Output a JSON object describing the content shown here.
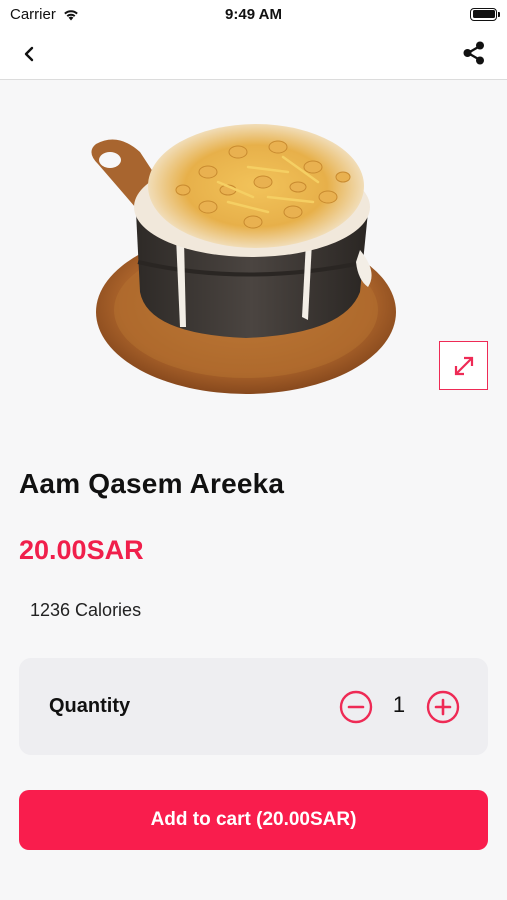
{
  "status_bar": {
    "carrier": "Carrier",
    "time": "9:49 AM",
    "icons": [
      "wifi-icon",
      "battery-icon"
    ]
  },
  "nav": {
    "back_icon": "chevron-left-icon",
    "share_icon": "share-icon"
  },
  "product": {
    "image": "dish-in-stone-pot-image",
    "name": "Aam Qasem Areeka",
    "price": "20.00SAR",
    "calories": "1236 Calories",
    "expand_icon": "expand-icon"
  },
  "quantity": {
    "label": "Quantity",
    "value": "1",
    "minus_icon": "minus-circle-icon",
    "plus_icon": "plus-circle-icon"
  },
  "cart": {
    "button_label": "Add to cart (20.00SAR)"
  },
  "colors": {
    "accent": "#f91d4d",
    "price": "#f01f4b",
    "background": "#f7f7f8",
    "card": "#eeeef1"
  }
}
